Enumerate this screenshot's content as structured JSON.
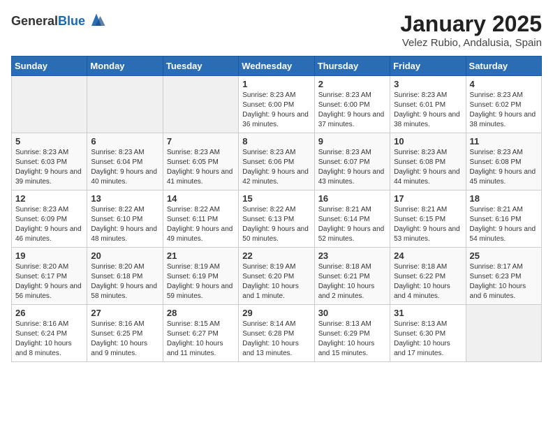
{
  "app": {
    "name_general": "General",
    "name_blue": "Blue"
  },
  "title": "January 2025",
  "location": "Velez Rubio, Andalusia, Spain",
  "headers": [
    "Sunday",
    "Monday",
    "Tuesday",
    "Wednesday",
    "Thursday",
    "Friday",
    "Saturday"
  ],
  "weeks": [
    [
      {
        "day": "",
        "info": ""
      },
      {
        "day": "",
        "info": ""
      },
      {
        "day": "",
        "info": ""
      },
      {
        "day": "1",
        "info": "Sunrise: 8:23 AM\nSunset: 6:00 PM\nDaylight: 9 hours and 36 minutes."
      },
      {
        "day": "2",
        "info": "Sunrise: 8:23 AM\nSunset: 6:00 PM\nDaylight: 9 hours and 37 minutes."
      },
      {
        "day": "3",
        "info": "Sunrise: 8:23 AM\nSunset: 6:01 PM\nDaylight: 9 hours and 38 minutes."
      },
      {
        "day": "4",
        "info": "Sunrise: 8:23 AM\nSunset: 6:02 PM\nDaylight: 9 hours and 38 minutes."
      }
    ],
    [
      {
        "day": "5",
        "info": "Sunrise: 8:23 AM\nSunset: 6:03 PM\nDaylight: 9 hours and 39 minutes."
      },
      {
        "day": "6",
        "info": "Sunrise: 8:23 AM\nSunset: 6:04 PM\nDaylight: 9 hours and 40 minutes."
      },
      {
        "day": "7",
        "info": "Sunrise: 8:23 AM\nSunset: 6:05 PM\nDaylight: 9 hours and 41 minutes."
      },
      {
        "day": "8",
        "info": "Sunrise: 8:23 AM\nSunset: 6:06 PM\nDaylight: 9 hours and 42 minutes."
      },
      {
        "day": "9",
        "info": "Sunrise: 8:23 AM\nSunset: 6:07 PM\nDaylight: 9 hours and 43 minutes."
      },
      {
        "day": "10",
        "info": "Sunrise: 8:23 AM\nSunset: 6:08 PM\nDaylight: 9 hours and 44 minutes."
      },
      {
        "day": "11",
        "info": "Sunrise: 8:23 AM\nSunset: 6:08 PM\nDaylight: 9 hours and 45 minutes."
      }
    ],
    [
      {
        "day": "12",
        "info": "Sunrise: 8:23 AM\nSunset: 6:09 PM\nDaylight: 9 hours and 46 minutes."
      },
      {
        "day": "13",
        "info": "Sunrise: 8:22 AM\nSunset: 6:10 PM\nDaylight: 9 hours and 48 minutes."
      },
      {
        "day": "14",
        "info": "Sunrise: 8:22 AM\nSunset: 6:11 PM\nDaylight: 9 hours and 49 minutes."
      },
      {
        "day": "15",
        "info": "Sunrise: 8:22 AM\nSunset: 6:13 PM\nDaylight: 9 hours and 50 minutes."
      },
      {
        "day": "16",
        "info": "Sunrise: 8:21 AM\nSunset: 6:14 PM\nDaylight: 9 hours and 52 minutes."
      },
      {
        "day": "17",
        "info": "Sunrise: 8:21 AM\nSunset: 6:15 PM\nDaylight: 9 hours and 53 minutes."
      },
      {
        "day": "18",
        "info": "Sunrise: 8:21 AM\nSunset: 6:16 PM\nDaylight: 9 hours and 54 minutes."
      }
    ],
    [
      {
        "day": "19",
        "info": "Sunrise: 8:20 AM\nSunset: 6:17 PM\nDaylight: 9 hours and 56 minutes."
      },
      {
        "day": "20",
        "info": "Sunrise: 8:20 AM\nSunset: 6:18 PM\nDaylight: 9 hours and 58 minutes."
      },
      {
        "day": "21",
        "info": "Sunrise: 8:19 AM\nSunset: 6:19 PM\nDaylight: 9 hours and 59 minutes."
      },
      {
        "day": "22",
        "info": "Sunrise: 8:19 AM\nSunset: 6:20 PM\nDaylight: 10 hours and 1 minute."
      },
      {
        "day": "23",
        "info": "Sunrise: 8:18 AM\nSunset: 6:21 PM\nDaylight: 10 hours and 2 minutes."
      },
      {
        "day": "24",
        "info": "Sunrise: 8:18 AM\nSunset: 6:22 PM\nDaylight: 10 hours and 4 minutes."
      },
      {
        "day": "25",
        "info": "Sunrise: 8:17 AM\nSunset: 6:23 PM\nDaylight: 10 hours and 6 minutes."
      }
    ],
    [
      {
        "day": "26",
        "info": "Sunrise: 8:16 AM\nSunset: 6:24 PM\nDaylight: 10 hours and 8 minutes."
      },
      {
        "day": "27",
        "info": "Sunrise: 8:16 AM\nSunset: 6:25 PM\nDaylight: 10 hours and 9 minutes."
      },
      {
        "day": "28",
        "info": "Sunrise: 8:15 AM\nSunset: 6:27 PM\nDaylight: 10 hours and 11 minutes."
      },
      {
        "day": "29",
        "info": "Sunrise: 8:14 AM\nSunset: 6:28 PM\nDaylight: 10 hours and 13 minutes."
      },
      {
        "day": "30",
        "info": "Sunrise: 8:13 AM\nSunset: 6:29 PM\nDaylight: 10 hours and 15 minutes."
      },
      {
        "day": "31",
        "info": "Sunrise: 8:13 AM\nSunset: 6:30 PM\nDaylight: 10 hours and 17 minutes."
      },
      {
        "day": "",
        "info": ""
      }
    ]
  ]
}
